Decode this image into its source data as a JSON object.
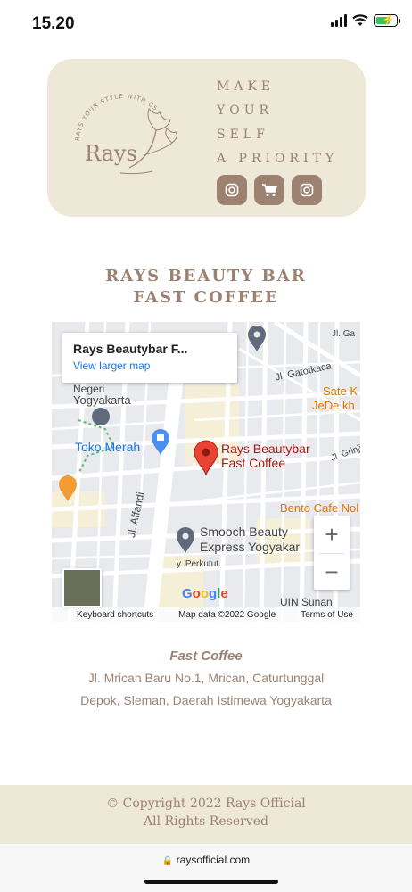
{
  "status_bar": {
    "time": "15.20"
  },
  "hero": {
    "logo_text": "Rays",
    "logo_arc_text": "RAYS YOUR STYLE WITH US",
    "tagline": [
      "MAKE",
      "YOUR",
      "SELF",
      "A PRIORITY"
    ],
    "social_icons": [
      "instagram-icon",
      "cart-icon",
      "instagram-icon"
    ],
    "colors": {
      "accent": "#9d8272",
      "card_bg": "#ede8d7"
    }
  },
  "title": {
    "line1": "RAYS BEAUTY BAR",
    "line2": "FAST COFFEE"
  },
  "map": {
    "info_title": "Rays Beautybar F...",
    "info_link": "View larger map",
    "labels": {
      "negeri": "Negeri",
      "yogyakarta": "Yogyakarta",
      "toko_merah": "Toko Merah",
      "jl_gatotkaca": "Jl. Gatotkaca",
      "sate_k": "Sate K",
      "jede_kh": "JeDe kh",
      "jl_grinjing": "Jl. Grinjing",
      "place_name_1": "Rays Beautybar",
      "place_name_2": "Fast Coffee",
      "bento": "Bento Cafe Nol",
      "jl_affandi": "Jl. Affandi",
      "smooch_1": "Smooch Beauty",
      "smooch_2": "Express Yogyakar",
      "perkutut": "y. Perkutut",
      "uin": "UIN Sunan",
      "jl_ga": "Jl. Ga"
    },
    "google": "Google",
    "footer": {
      "shortcuts": "Keyboard shortcuts",
      "data": "Map data ©2022 Google",
      "terms": "Terms of Use"
    },
    "zoom_in": "+",
    "zoom_out": "−"
  },
  "address": {
    "name": "Fast Coffee",
    "line1": "Jl. Mrican Baru No.1, Mrican, Caturtunggal",
    "line2": "Depok, Sleman, Daerah Istimewa Yogyakarta"
  },
  "footer": {
    "copyright": "© Copyright 2022 Rays Official",
    "rights": "All Rights Reserved"
  },
  "browser": {
    "url": "raysofficial.com"
  }
}
